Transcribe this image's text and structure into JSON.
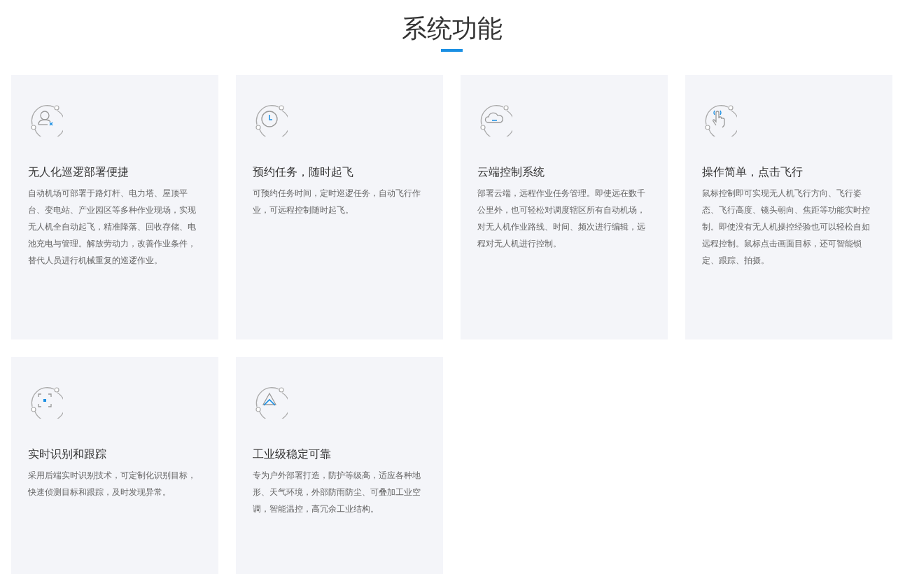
{
  "section": {
    "title": "系统功能"
  },
  "features": [
    {
      "kind": "user",
      "title": "无人化巡逻部署便捷",
      "description": "自动机场可部署于路灯杆、电力塔、屋顶平台、变电站、产业园区等多种作业现场，实现无人机全自动起飞，精准降落、回收存储、电池充电与管理。解放劳动力，改善作业条件，替代人员进行机械重复的巡逻作业。"
    },
    {
      "kind": "clock",
      "title": "预约任务，随时起飞",
      "description": "可预约任务时间，定时巡逻任务，自动飞行作业，可远程控制随时起飞。"
    },
    {
      "kind": "cloud",
      "title": "云端控制系统",
      "description": "部署云端，远程作业任务管理。即使远在数千公里外，也可轻松对调度辖区所有自动机场，对无人机作业路线、时间、频次进行编辑，远程对无人机进行控制。"
    },
    {
      "kind": "hand",
      "title": "操作简单，点击飞行",
      "description": "鼠标控制即可实现无人机飞行方向、飞行姿态、飞行高度、镜头朝向、焦距等功能实时控制。即使没有无人机操控经验也可以轻松自如远程控制。鼠标点击画面目标，还可智能锁定、跟踪、拍摄。"
    },
    {
      "kind": "target",
      "title": "实时识别和跟踪",
      "description": "采用后端实时识别技术，可定制化识别目标，快速侦测目标和跟踪，及时发现异常。"
    },
    {
      "kind": "triangle",
      "title": "工业级稳定可靠",
      "description": "专为户外部署打造，防护等级高，适应各种地形、天气环境，外部防雨防尘、可叠加工业空调，智能温控，高冗余工业结构。"
    }
  ]
}
